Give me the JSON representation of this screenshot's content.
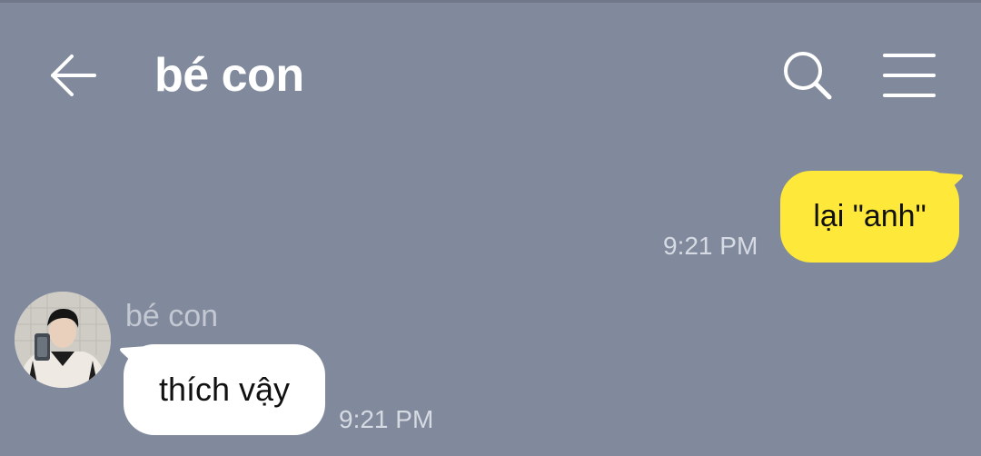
{
  "header": {
    "title": "bé con",
    "back_icon": "arrow-left-icon",
    "search_icon": "search-icon",
    "menu_icon": "hamburger-menu-icon"
  },
  "messages": [
    {
      "direction": "sent",
      "text": "lại \"anh\"",
      "time": "9:21 PM",
      "bubble_color": "#fee93a"
    },
    {
      "direction": "received",
      "sender": "bé con",
      "text": "thích vậy",
      "time": "9:21 PM",
      "bubble_color": "#ffffff"
    }
  ],
  "colors": {
    "background": "#818a9c",
    "sent_bubble": "#fee93a",
    "received_bubble": "#ffffff"
  }
}
